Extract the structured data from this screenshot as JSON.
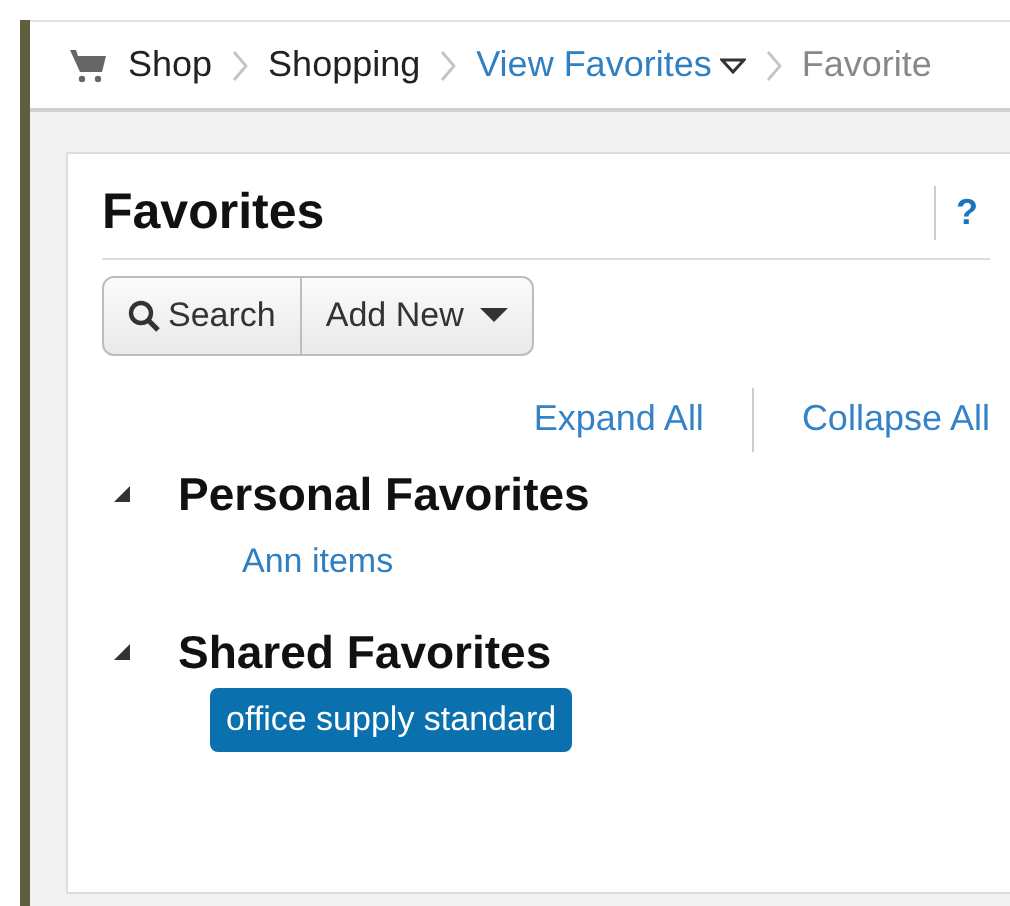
{
  "breadcrumb": [
    {
      "label": "Shop",
      "kind": "home",
      "dropdown": false
    },
    {
      "label": "Shopping",
      "kind": "plain",
      "dropdown": false
    },
    {
      "label": "View Favorites",
      "kind": "link",
      "dropdown": true
    },
    {
      "label": "Favorite",
      "kind": "current",
      "dropdown": false
    }
  ],
  "panel": {
    "title": "Favorites",
    "help": "?"
  },
  "toolbar": [
    {
      "label": "Search",
      "kind": "search"
    },
    {
      "label": "Add New",
      "kind": "menu"
    }
  ],
  "tree_actions": [
    "Expand All",
    "Collapse All"
  ],
  "groups": [
    {
      "title": "Personal Favorites",
      "expanded": true,
      "children": [
        {
          "label": "Ann items",
          "selected": false
        }
      ]
    },
    {
      "title": "Shared Favorites",
      "expanded": true,
      "children": [
        {
          "label": "office supply standard",
          "selected": true
        }
      ]
    }
  ]
}
